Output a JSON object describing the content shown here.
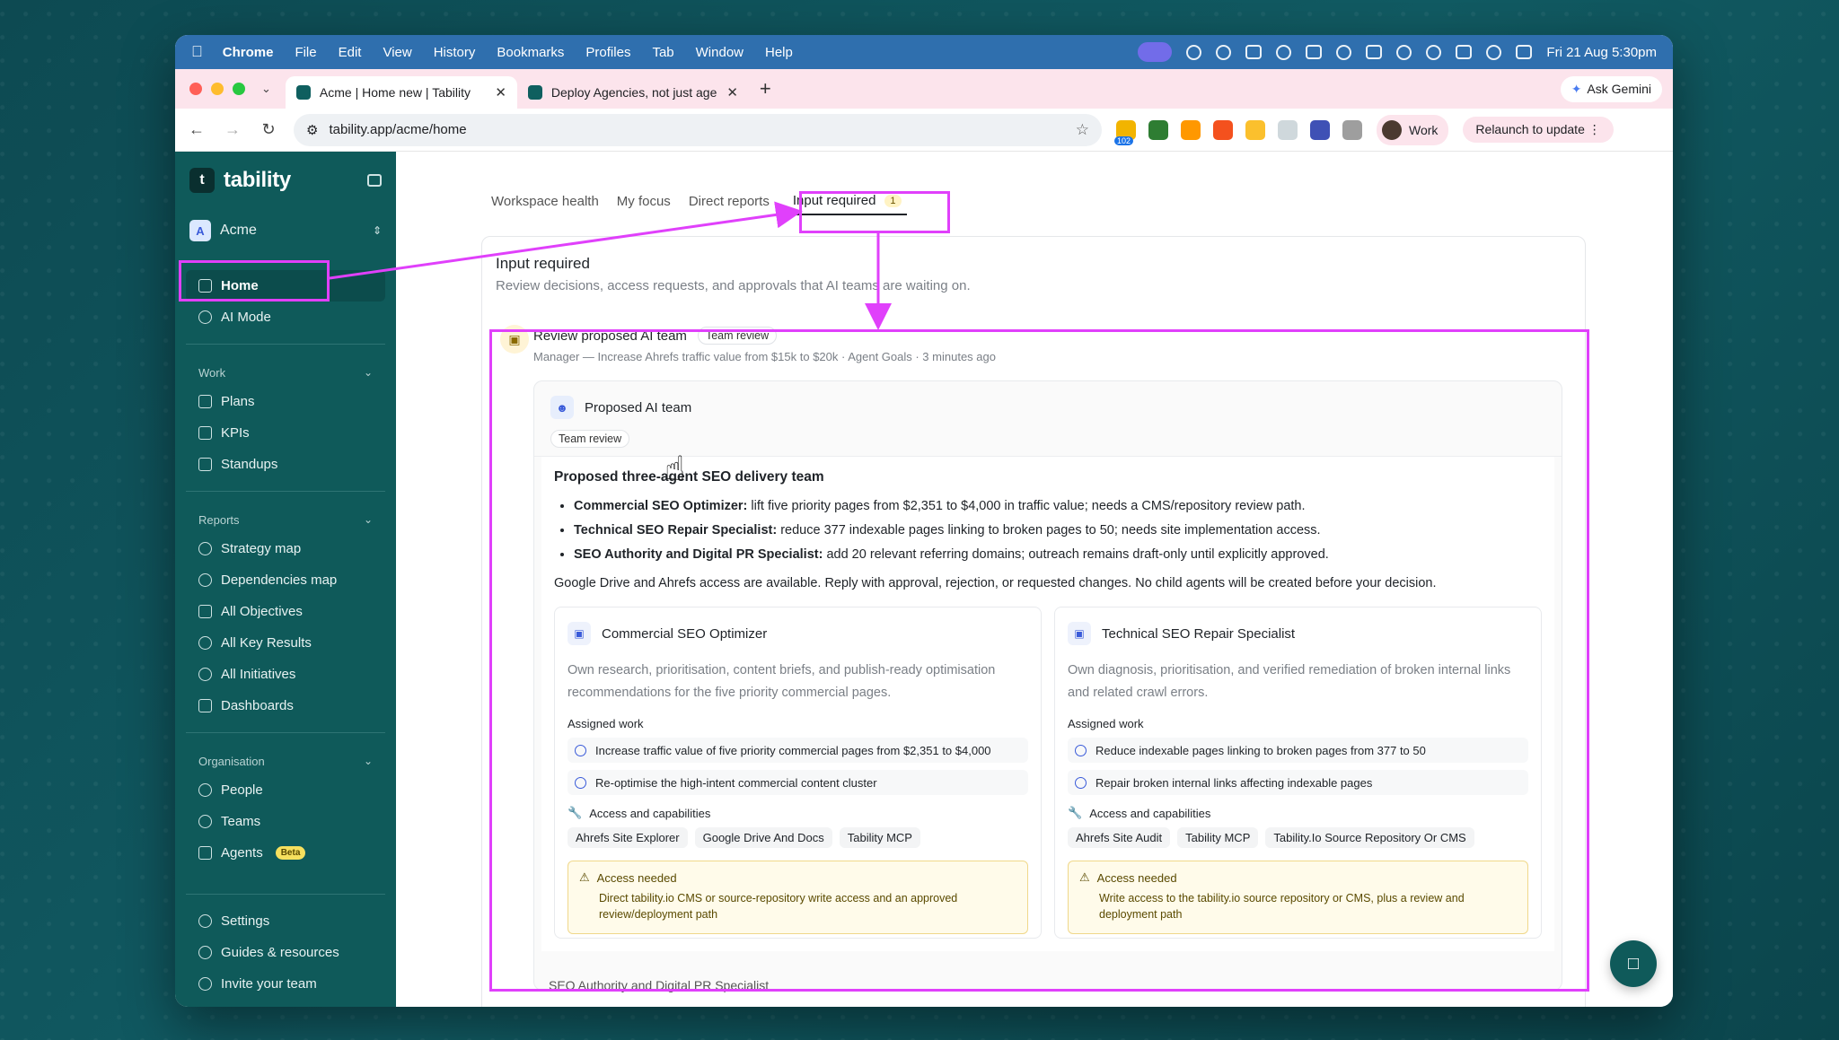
{
  "menubar": {
    "items": [
      "Chrome",
      "File",
      "Edit",
      "View",
      "History",
      "Bookmarks",
      "Profiles",
      "Tab",
      "Window",
      "Help"
    ],
    "clock": "Fri 21 Aug  5:30pm"
  },
  "browser": {
    "tabs": [
      {
        "title": "Acme | Home new | Tability",
        "active": true
      },
      {
        "title": "Deploy Agencies, not just age",
        "active": false
      }
    ],
    "new_tab": "+",
    "ask_gemini": "Ask Gemini",
    "url": "tability.app/acme/home",
    "extension_badge": "102",
    "profile": "Work",
    "relaunch": "Relaunch to update"
  },
  "sidebar": {
    "brand": "tability",
    "workspace": "Acme",
    "workspace_initial": "A",
    "top_items": [
      {
        "label": "Home",
        "active": true
      },
      {
        "label": "AI Mode"
      }
    ],
    "sections": [
      {
        "title": "Work",
        "items": [
          "Plans",
          "KPIs",
          "Standups"
        ]
      },
      {
        "title": "Reports",
        "items": [
          "Strategy map",
          "Dependencies map",
          "All Objectives",
          "All Key Results",
          "All Initiatives",
          "Dashboards"
        ]
      },
      {
        "title": "Organisation",
        "items": [
          "People",
          "Teams",
          "Agents"
        ]
      }
    ],
    "agents_badge": "Beta",
    "bottom_items": [
      "Settings",
      "Guides & resources",
      "Invite your team"
    ]
  },
  "main": {
    "tabs": [
      "Workspace health",
      "My focus",
      "Direct reports",
      "Input required"
    ],
    "input_required_count": "1",
    "panel_title": "Input required",
    "panel_subtitle": "Review decisions, access requests, and approvals that AI teams are waiting on.",
    "review": {
      "title": "Review proposed AI team",
      "chip": "Team review",
      "meta": "Manager — Increase Ahrefs traffic value from $15k to $20k · Agent Goals · 3 minutes ago",
      "proposal_title": "Proposed AI team",
      "proposal_chip": "Team review",
      "body_title": "Proposed three-agent SEO delivery team",
      "bullets": [
        {
          "label": "Commercial SEO Optimizer:",
          "text": " lift five priority pages from $2,351 to $4,000 in traffic value; needs a CMS/repository review path."
        },
        {
          "label": "Technical SEO Repair Specialist:",
          "text": " reduce 377 indexable pages linking to broken pages to 50; needs site implementation access."
        },
        {
          "label": "SEO Authority and Digital PR Specialist:",
          "text": " add 20 relevant referring domains; outreach remains draft-only until explicitly approved."
        }
      ],
      "note": "Google Drive and Ahrefs access are available. Reply with approval, rejection, or requested changes. No child agents will be created before your decision.",
      "agents": [
        {
          "name": "Commercial SEO Optimizer",
          "desc": "Own research, prioritisation, content briefs, and publish-ready optimisation recommendations for the five priority commercial pages.",
          "assigned_label": "Assigned work",
          "work": [
            "Increase traffic value of five priority commercial pages from $2,351 to $4,000",
            "Re-optimise the high-intent commercial content cluster"
          ],
          "cap_label": "Access and capabilities",
          "caps": [
            "Ahrefs Site Explorer",
            "Google Drive And Docs",
            "Tability MCP"
          ],
          "access_title": "Access needed",
          "access_text": "Direct tability.io CMS or source-repository write access and an approved review/deployment path"
        },
        {
          "name": "Technical SEO Repair Specialist",
          "desc": "Own diagnosis, prioritisation, and verified remediation of broken internal links and related crawl errors.",
          "assigned_label": "Assigned work",
          "work": [
            "Reduce indexable pages linking to broken pages from 377 to 50",
            "Repair broken internal links affecting indexable pages"
          ],
          "cap_label": "Access and capabilities",
          "caps": [
            "Ahrefs Site Audit",
            "Tability MCP",
            "Tability.Io Source Repository Or CMS"
          ],
          "access_title": "Access needed",
          "access_text": "Write access to the tability.io source repository or CMS, plus a review and deployment path"
        }
      ],
      "next_peek": "SEO Authority and Digital PR Specialist"
    }
  },
  "colors": {
    "sidebar": "#0f5a5a",
    "highlight": "#e040fb",
    "accent": "#3a5bd9"
  }
}
